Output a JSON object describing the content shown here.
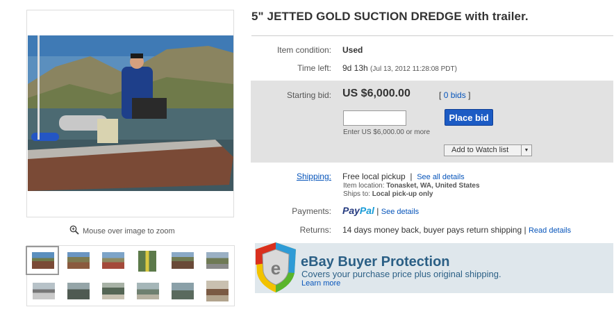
{
  "title": "5\" JETTED GOLD SUCTION DREDGE with trailer.",
  "zoom_hint": "Mouse over image to zoom",
  "condition": {
    "label": "Item condition:",
    "value": "Used"
  },
  "time_left": {
    "label": "Time left:",
    "value": "9d 13h",
    "end": "(Jul 13, 2012 11:28:08 PDT)"
  },
  "bid": {
    "label": "Starting bid:",
    "amount": "US $6,000.00",
    "bids_open": "[",
    "bids_link": "0 bids",
    "bids_close": "]",
    "input_value": "",
    "hint": "Enter US $6,000.00 or more",
    "place_bid": "Place bid",
    "watch": "Add to Watch list",
    "watch_arrow": "▼"
  },
  "shipping": {
    "label": "Shipping:",
    "value": "Free local pickup",
    "sep": "|",
    "link": "See all details",
    "location_label": "Item location:",
    "location": "Tonasket, WA, United States",
    "ships_label": "Ships to:",
    "ships": "Local pick-up only"
  },
  "payments": {
    "label": "Payments:",
    "paypal_pay": "Pay",
    "paypal_pal": "Pal",
    "sep": "|",
    "link": "See details"
  },
  "returns": {
    "label": "Returns:",
    "value": "14 days money back, buyer pays return shipping",
    "sep": "|",
    "link": "Read details"
  },
  "protection": {
    "title": "eBay Buyer Protection",
    "subtitle": "Covers your purchase price plus original shipping.",
    "link": "Learn more",
    "badge_letter": "e"
  },
  "colors": {
    "link": "#0654ba",
    "button": "#1c5bc4",
    "paypal_dark": "#253b80",
    "paypal_light": "#179bd7"
  }
}
